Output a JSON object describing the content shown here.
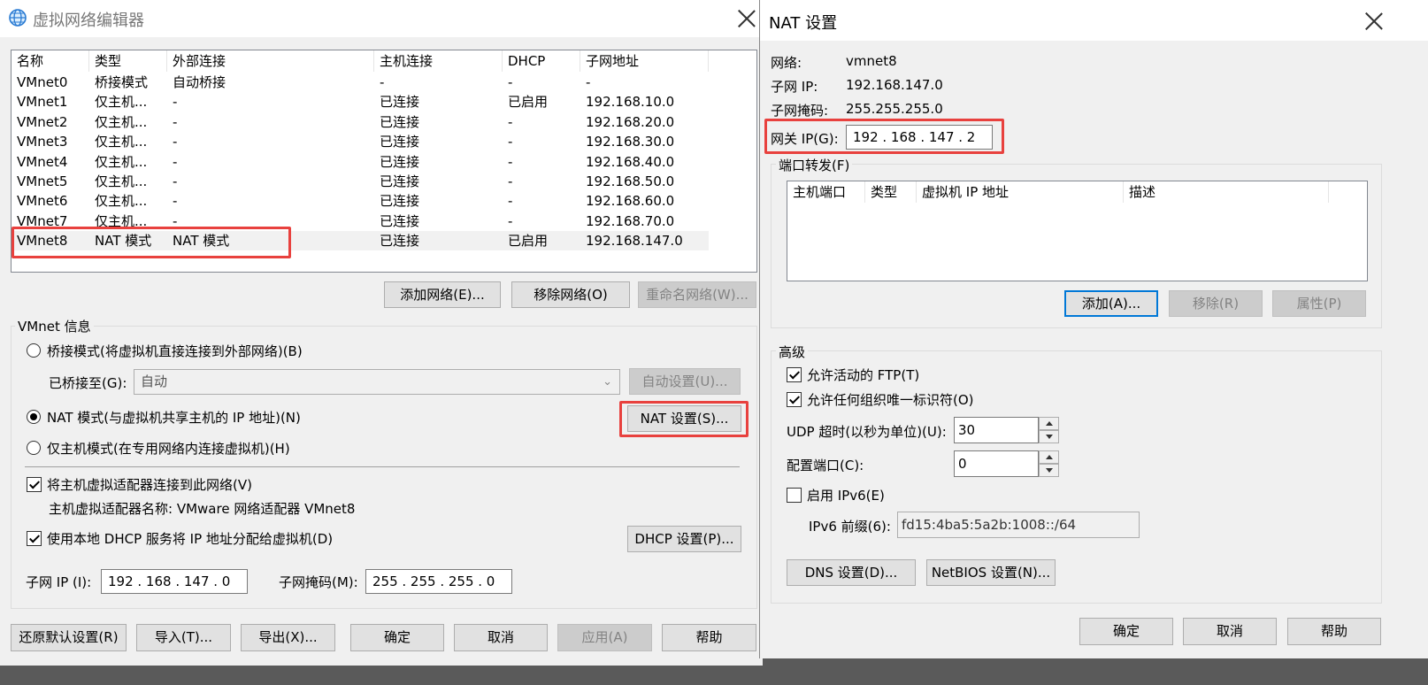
{
  "left": {
    "title": "虚拟网络编辑器",
    "columns": [
      "名称",
      "类型",
      "外部连接",
      "主机连接",
      "DHCP",
      "子网地址"
    ],
    "rows": [
      [
        "VMnet0",
        "桥接模式",
        "自动桥接",
        "-",
        "-",
        "-"
      ],
      [
        "VMnet1",
        "仅主机...",
        "-",
        "已连接",
        "已启用",
        "192.168.10.0"
      ],
      [
        "VMnet2",
        "仅主机...",
        "-",
        "已连接",
        "-",
        "192.168.20.0"
      ],
      [
        "VMnet3",
        "仅主机...",
        "-",
        "已连接",
        "-",
        "192.168.30.0"
      ],
      [
        "VMnet4",
        "仅主机...",
        "-",
        "已连接",
        "-",
        "192.168.40.0"
      ],
      [
        "VMnet5",
        "仅主机...",
        "-",
        "已连接",
        "-",
        "192.168.50.0"
      ],
      [
        "VMnet6",
        "仅主机...",
        "-",
        "已连接",
        "-",
        "192.168.60.0"
      ],
      [
        "VMnet7",
        "仅主机...",
        "-",
        "已连接",
        "-",
        "192.168.70.0"
      ],
      [
        "VMnet8",
        "NAT 模式",
        "NAT 模式",
        "已连接",
        "已启用",
        "192.168.147.0"
      ]
    ],
    "add_network": "添加网络(E)...",
    "remove_network": "移除网络(O)",
    "rename_network": "重命名网络(W)...",
    "vmnet_info": "VMnet 信息",
    "bridge_mode": "桥接模式(将虚拟机直接连接到外部网络)(B)",
    "bridged_to": "已桥接至(G):",
    "bridged_value": "自动",
    "auto_settings": "自动设置(U)...",
    "nat_mode": "NAT 模式(与虚拟机共享主机的 IP 地址)(N)",
    "nat_settings": "NAT 设置(S)...",
    "host_only": "仅主机模式(在专用网络内连接虚拟机)(H)",
    "connect_adapter": "将主机虚拟适配器连接到此网络(V)",
    "adapter_name": "主机虚拟适配器名称: VMware 网络适配器 VMnet8",
    "use_dhcp": "使用本地 DHCP 服务将 IP 地址分配给虚拟机(D)",
    "dhcp_settings": "DHCP 设置(P)...",
    "subnet_ip_label": "子网 IP (I):",
    "subnet_ip": "192 . 168 . 147 .  0",
    "subnet_mask_label": "子网掩码(M):",
    "subnet_mask": "255 . 255 . 255 .  0",
    "restore_defaults": "还原默认设置(R)",
    "import": "导入(T)...",
    "export": "导出(X)...",
    "ok": "确定",
    "cancel": "取消",
    "apply": "应用(A)",
    "help": "帮助"
  },
  "nat": {
    "title": "NAT 设置",
    "network_label": "网络:",
    "network_value": "vmnet8",
    "subnet_ip_label": "子网 IP:",
    "subnet_ip_value": "192.168.147.0",
    "subnet_mask_label": "子网掩码:",
    "subnet_mask_value": "255.255.255.0",
    "gateway_label": "网关 IP(G):",
    "gateway_value": "192 . 168 . 147 .  2",
    "port_forwarding": "端口转发(F)",
    "pf_columns": [
      "主机端口",
      "类型",
      "虚拟机 IP 地址",
      "描述"
    ],
    "add": "添加(A)...",
    "remove": "移除(R)",
    "properties": "属性(P)",
    "advanced": "高级",
    "allow_ftp": "允许活动的 FTP(T)",
    "allow_oui": "允许任何组织唯一标识符(O)",
    "udp_timeout_label": "UDP 超时(以秒为单位)(U):",
    "udp_timeout_value": "30",
    "config_port_label": "配置端口(C):",
    "config_port_value": "0",
    "enable_ipv6": "启用 IPv6(E)",
    "ipv6_prefix_label": "IPv6 前缀(6):",
    "ipv6_prefix_value": "fd15:4ba5:5a2b:1008::/64",
    "dns_settings": "DNS 设置(D)...",
    "netbios_settings": "NetBIOS 设置(N)...",
    "ok": "确定",
    "cancel": "取消",
    "help": "帮助"
  },
  "colors": {
    "highlight": "#e8413e",
    "default_button_border": "#0078d7"
  }
}
